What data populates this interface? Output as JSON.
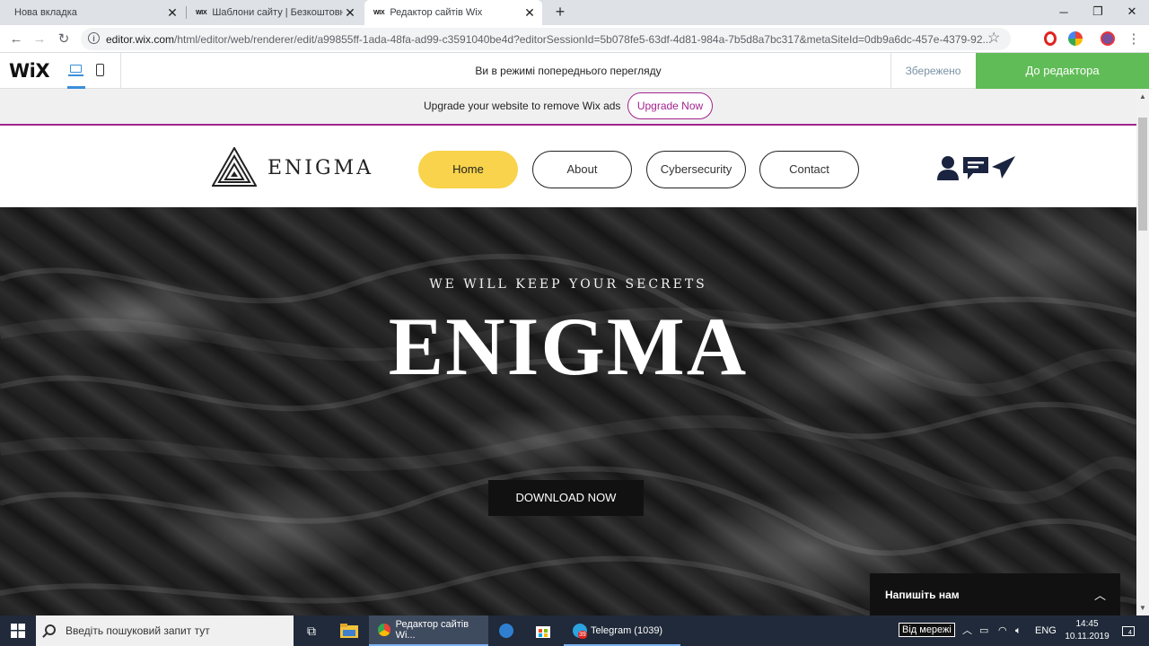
{
  "browser": {
    "tabs": [
      {
        "title": "Нова вкладка"
      },
      {
        "title": "Шаблони сайту | Безкоштовні шаблони",
        "favicon": "WIX"
      },
      {
        "title": "Редактор сайтів Wix",
        "favicon": "WIX"
      }
    ],
    "url_host": "editor.wix.com",
    "url_path": "/html/editor/web/renderer/edit/a99855ff-1ada-48fa-ad99-c3591040be4d?editorSessionId=5b078fe5-63df-4d81-984a-7b5d8a7bc317&metaSiteId=0db9a6dc-457e-4379-92..."
  },
  "wix_bar": {
    "logo": "WiX",
    "preview_text": "Ви в режимі попереднього перегляду",
    "saved": "Збережено",
    "to_editor": "До редактора"
  },
  "ad_bar": {
    "text": "Upgrade your website to remove Wix ads",
    "button": "Upgrade Now"
  },
  "site": {
    "brand": "ENIGMA",
    "nav": [
      {
        "label": "Home",
        "active": true
      },
      {
        "label": "About",
        "active": false
      },
      {
        "label": "Cybersecurity",
        "active": false
      },
      {
        "label": "Contact",
        "active": false
      }
    ],
    "hero": {
      "tagline": "WE WILL KEEP YOUR SECRETS",
      "title": "ENIGMA",
      "button": "DOWNLOAD NOW"
    },
    "chat": {
      "label": "Напишіть нам"
    },
    "colors": {
      "nav_active": "#f8d34b",
      "wix_green": "#60bc57",
      "upgrade_accent": "#a3238e"
    }
  },
  "taskbar": {
    "search_placeholder": "Введіть пошуковий запит тут",
    "apps": [
      {
        "label": "Редактор сайтів Wi..."
      },
      {
        "label": "Telegram (1039)"
      }
    ],
    "telegram_badge": "39",
    "offline_tooltip": "Від мережі",
    "language": "ENG",
    "time": "14:45",
    "date": "10.11.2019",
    "notification_count": "4"
  }
}
